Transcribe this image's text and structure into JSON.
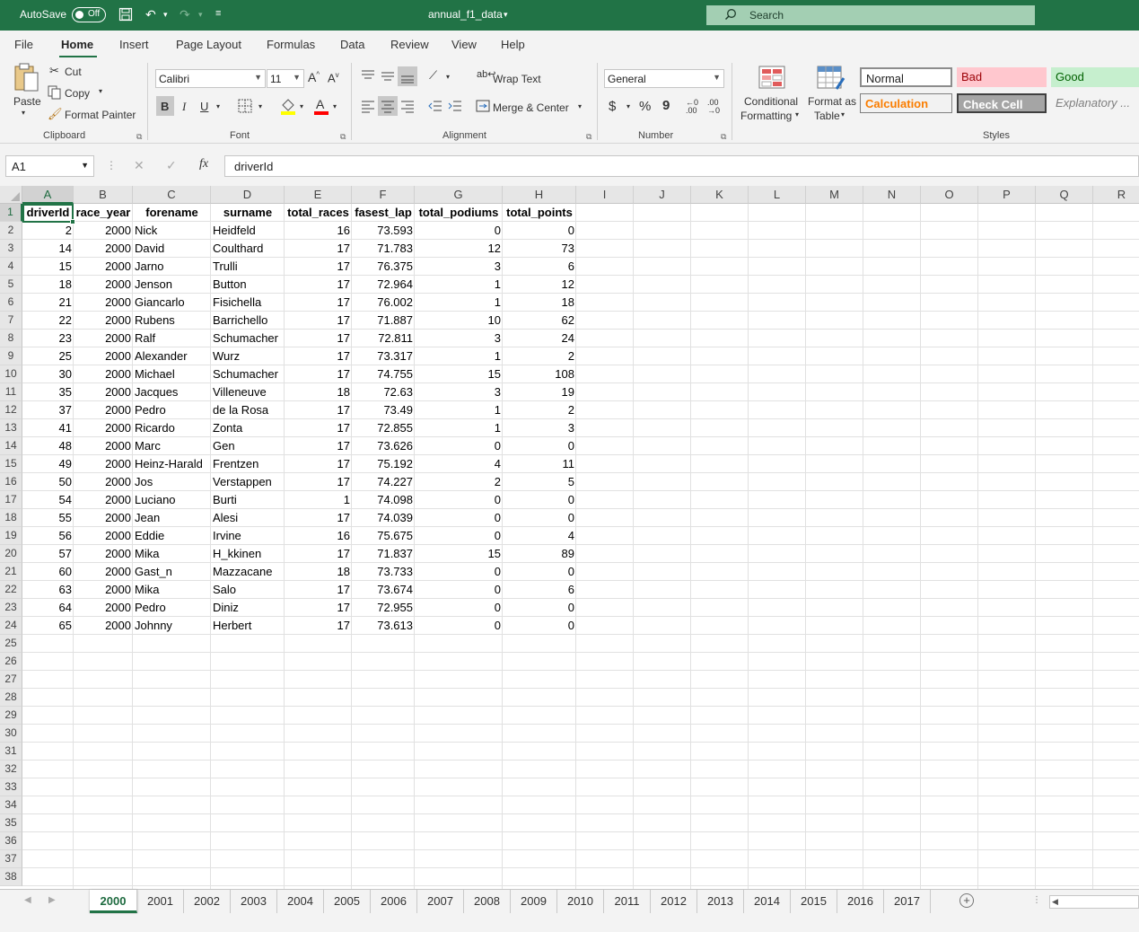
{
  "titlebar": {
    "autosave_label": "AutoSave",
    "autosave_state": "Off",
    "doc_title": "annual_f1_data",
    "search_placeholder": "Search",
    "brand_color": "#217346"
  },
  "menu": {
    "file": "File",
    "home": "Home",
    "insert": "Insert",
    "page_layout": "Page Layout",
    "formulas": "Formulas",
    "data": "Data",
    "review": "Review",
    "view": "View",
    "help": "Help"
  },
  "ribbon": {
    "clipboard": {
      "paste": "Paste",
      "cut": "Cut",
      "copy": "Copy",
      "format_painter": "Format Painter",
      "label": "Clipboard"
    },
    "font": {
      "font_name": "Calibri",
      "font_size": "11",
      "bold": "B",
      "italic": "I",
      "underline": "U",
      "label": "Font"
    },
    "alignment": {
      "wrap_text": "Wrap Text",
      "merge_center": "Merge & Center",
      "label": "Alignment"
    },
    "number": {
      "format": "General",
      "currency": "$",
      "percent": "%",
      "comma": "9",
      "label": "Number"
    },
    "styles": {
      "conditional_1": "Conditional",
      "conditional_2": "Formatting",
      "format_table_1": "Format as",
      "format_table_2": "Table",
      "normal": "Normal",
      "bad": "Bad",
      "good": "Good",
      "calculation": "Calculation",
      "check_cell": "Check Cell",
      "explanatory": "Explanatory ...",
      "label": "Styles"
    }
  },
  "formula_bar": {
    "name_box": "A1",
    "fx": "fx",
    "content": "driverId"
  },
  "columns": [
    "A",
    "B",
    "C",
    "D",
    "E",
    "F",
    "G",
    "H",
    "I",
    "J",
    "K",
    "L",
    "M",
    "N",
    "O",
    "P",
    "Q",
    "R"
  ],
  "row_numbers": [
    "1",
    "2",
    "3",
    "4",
    "5",
    "6",
    "7",
    "8",
    "9",
    "10",
    "11",
    "12",
    "13",
    "14",
    "15",
    "16",
    "17",
    "18",
    "19",
    "20",
    "21",
    "22",
    "23",
    "24",
    "25",
    "26",
    "27",
    "28",
    "29",
    "30",
    "31",
    "32",
    "33",
    "34",
    "35",
    "36",
    "37",
    "38"
  ],
  "table": {
    "headers": [
      "driverId",
      "race_year",
      "forename",
      "surname",
      "total_races",
      "fasest_lap",
      "total_podiums",
      "total_points"
    ],
    "rows": [
      [
        "2",
        "2000",
        "Nick",
        "Heidfeld",
        "16",
        "73.593",
        "0",
        "0"
      ],
      [
        "14",
        "2000",
        "David",
        "Coulthard",
        "17",
        "71.783",
        "12",
        "73"
      ],
      [
        "15",
        "2000",
        "Jarno",
        "Trulli",
        "17",
        "76.375",
        "3",
        "6"
      ],
      [
        "18",
        "2000",
        "Jenson",
        "Button",
        "17",
        "72.964",
        "1",
        "12"
      ],
      [
        "21",
        "2000",
        "Giancarlo",
        "Fisichella",
        "17",
        "76.002",
        "1",
        "18"
      ],
      [
        "22",
        "2000",
        "Rubens",
        "Barrichello",
        "17",
        "71.887",
        "10",
        "62"
      ],
      [
        "23",
        "2000",
        "Ralf",
        "Schumacher",
        "17",
        "72.811",
        "3",
        "24"
      ],
      [
        "25",
        "2000",
        "Alexander",
        "Wurz",
        "17",
        "73.317",
        "1",
        "2"
      ],
      [
        "30",
        "2000",
        "Michael",
        "Schumacher",
        "17",
        "74.755",
        "15",
        "108"
      ],
      [
        "35",
        "2000",
        "Jacques",
        "Villeneuve",
        "18",
        "72.63",
        "3",
        "19"
      ],
      [
        "37",
        "2000",
        "Pedro",
        "de la Rosa",
        "17",
        "73.49",
        "1",
        "2"
      ],
      [
        "41",
        "2000",
        "Ricardo",
        "Zonta",
        "17",
        "72.855",
        "1",
        "3"
      ],
      [
        "48",
        "2000",
        "Marc",
        "Gen",
        "17",
        "73.626",
        "0",
        "0"
      ],
      [
        "49",
        "2000",
        "Heinz-Harald",
        "Frentzen",
        "17",
        "75.192",
        "4",
        "11"
      ],
      [
        "50",
        "2000",
        "Jos",
        "Verstappen",
        "17",
        "74.227",
        "2",
        "5"
      ],
      [
        "54",
        "2000",
        "Luciano",
        "Burti",
        "1",
        "74.098",
        "0",
        "0"
      ],
      [
        "55",
        "2000",
        "Jean",
        "Alesi",
        "17",
        "74.039",
        "0",
        "0"
      ],
      [
        "56",
        "2000",
        "Eddie",
        "Irvine",
        "16",
        "75.675",
        "0",
        "4"
      ],
      [
        "57",
        "2000",
        "Mika",
        "H_kkinen",
        "17",
        "71.837",
        "15",
        "89"
      ],
      [
        "60",
        "2000",
        "Gast_n",
        "Mazzacane",
        "18",
        "73.733",
        "0",
        "0"
      ],
      [
        "63",
        "2000",
        "Mika",
        "Salo",
        "17",
        "73.674",
        "0",
        "6"
      ],
      [
        "64",
        "2000",
        "Pedro",
        "Diniz",
        "17",
        "72.955",
        "0",
        "0"
      ],
      [
        "65",
        "2000",
        "Johnny",
        "Herbert",
        "17",
        "73.613",
        "0",
        "0"
      ]
    ]
  },
  "sheets": [
    "2000",
    "2001",
    "2002",
    "2003",
    "2004",
    "2005",
    "2006",
    "2007",
    "2008",
    "2009",
    "2010",
    "2011",
    "2012",
    "2013",
    "2014",
    "2015",
    "2016",
    "2017"
  ],
  "active_sheet": "2000"
}
